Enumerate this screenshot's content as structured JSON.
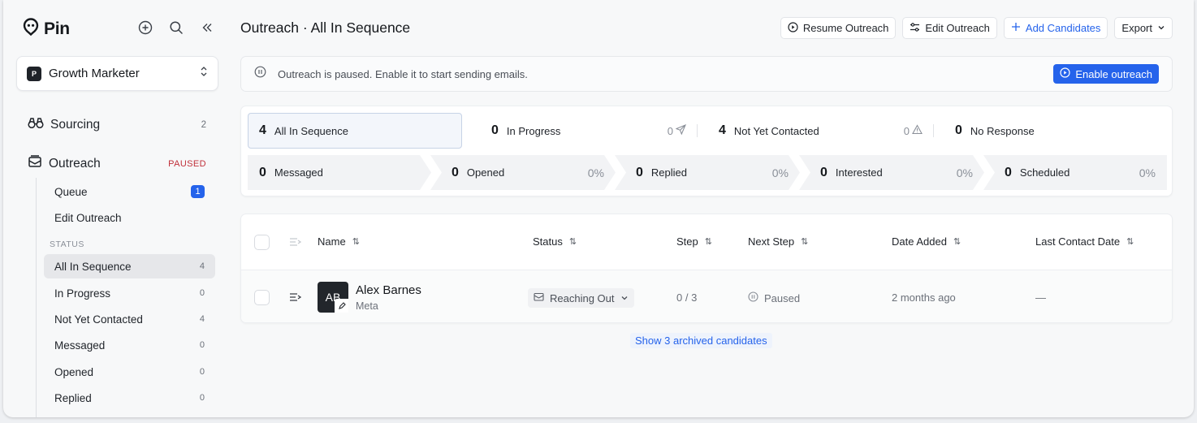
{
  "app": {
    "brand": "Pin"
  },
  "workspace": {
    "badge": "P",
    "name": "Growth Marketer"
  },
  "nav": {
    "sourcing": {
      "label": "Sourcing",
      "count": "2"
    },
    "outreach": {
      "label": "Outreach",
      "badge": "PAUSED"
    },
    "queue": {
      "label": "Queue",
      "count": "1"
    },
    "edit_outreach": {
      "label": "Edit Outreach"
    },
    "status_label": "STATUS",
    "status_items": [
      {
        "label": "All In Sequence",
        "count": "4"
      },
      {
        "label": "In Progress",
        "count": "0"
      },
      {
        "label": "Not Yet Contacted",
        "count": "4"
      },
      {
        "label": "Messaged",
        "count": "0"
      },
      {
        "label": "Opened",
        "count": "0"
      },
      {
        "label": "Replied",
        "count": "0"
      }
    ]
  },
  "header": {
    "title": "Outreach · All In Sequence",
    "resume_label": "Resume Outreach",
    "edit_label": "Edit Outreach",
    "add_label": "Add Candidates",
    "export_label": "Export"
  },
  "banner": {
    "text": "Outreach is paused. Enable it to start sending emails.",
    "button_label": "Enable outreach"
  },
  "stats": {
    "row1": [
      {
        "num": "4",
        "label": "All In Sequence",
        "aux": ""
      },
      {
        "num": "0",
        "label": "In Progress",
        "aux": "0"
      },
      {
        "num": "4",
        "label": "Not Yet Contacted",
        "aux": "0"
      },
      {
        "num": "0",
        "label": "No Response",
        "aux": ""
      }
    ],
    "row2": [
      {
        "num": "0",
        "label": "Messaged",
        "pct": ""
      },
      {
        "num": "0",
        "label": "Opened",
        "pct": "0%"
      },
      {
        "num": "0",
        "label": "Replied",
        "pct": "0%"
      },
      {
        "num": "0",
        "label": "Interested",
        "pct": "0%"
      },
      {
        "num": "0",
        "label": "Scheduled",
        "pct": "0%"
      }
    ]
  },
  "table": {
    "columns": {
      "name": "Name",
      "status": "Status",
      "step": "Step",
      "next_step": "Next Step",
      "date_added": "Date Added",
      "last_contact": "Last Contact Date"
    },
    "rows": [
      {
        "initials": "AB",
        "name": "Alex Barnes",
        "company": "Meta",
        "status": "Reaching Out",
        "step": "0 / 3",
        "next_step": "Paused",
        "date_added": "2 months ago",
        "last_contact": "—"
      }
    ],
    "archived_link": "Show 3 archived candidates"
  },
  "colors": {
    "accent": "#2563eb",
    "paused": "#c0303a"
  }
}
